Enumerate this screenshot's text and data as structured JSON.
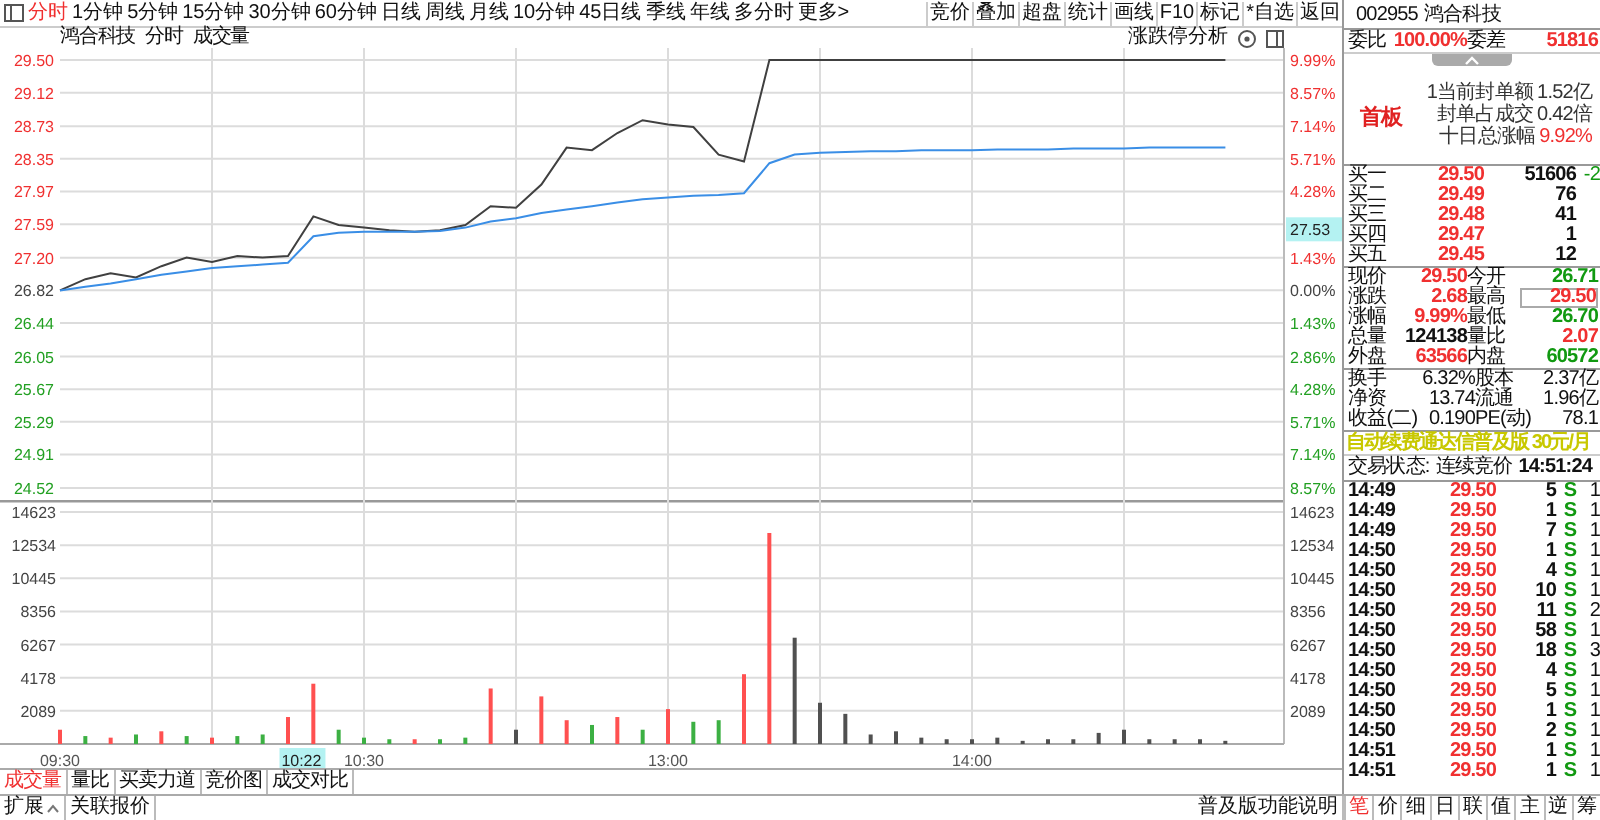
{
  "toolbar": {
    "period_tabs": [
      {
        "label": "分时",
        "selected": true
      },
      {
        "label": "1分钟",
        "selected": false
      },
      {
        "label": "5分钟",
        "selected": false
      },
      {
        "label": "15分钟",
        "selected": false
      },
      {
        "label": "30分钟",
        "selected": false
      },
      {
        "label": "60分钟",
        "selected": false
      },
      {
        "label": "日线",
        "selected": false
      },
      {
        "label": "周线",
        "selected": false
      },
      {
        "label": "月线",
        "selected": false
      },
      {
        "label": "10分钟",
        "selected": false
      },
      {
        "label": "45日线",
        "selected": false
      },
      {
        "label": "季线",
        "selected": false
      },
      {
        "label": "年线",
        "selected": false
      },
      {
        "label": "多分时",
        "selected": false
      },
      {
        "label": "更多>",
        "selected": false
      }
    ],
    "tools": [
      "竞价",
      "叠加",
      "超盘",
      "统计",
      "画线",
      "F10",
      "标记",
      "*自选",
      "返回"
    ]
  },
  "chart": {
    "header": {
      "name": "鸿合科技",
      "mode": "分时",
      "indicator": "成交量",
      "analysis": "涨跌停分析"
    },
    "price": {
      "cursor_label": "27.53",
      "right_ticks": [
        "9.99%",
        "8.57%",
        "7.14%",
        "5.71%",
        "4.28%",
        "1.43%",
        "0.00%",
        "1.43%",
        "2.86%",
        "4.28%",
        "5.71%",
        "7.14%",
        "8.57%"
      ],
      "chart_data": {
        "type": "line",
        "grid": true,
        "categories": [
          null,
          null,
          null,
          null,
          null,
          null,
          null,
          null,
          null,
          null,
          null,
          null,
          null,
          null,
          null,
          null,
          null,
          null,
          null,
          null,
          null,
          null,
          null,
          null,
          null,
          null,
          null,
          null,
          null,
          null,
          null,
          null,
          null,
          null,
          null,
          null,
          null,
          null,
          null,
          null,
          null,
          null,
          null,
          null,
          null,
          null,
          null
        ],
        "series": [
          {
            "color": "#404040",
            "values": [
              26.82,
              26.95,
              27.02,
              26.97,
              27.1,
              27.2,
              27.15,
              27.22,
              27.2,
              27.22,
              27.68,
              27.58,
              27.55,
              27.52,
              27.5,
              27.52,
              27.58,
              27.8,
              27.78,
              28.05,
              28.48,
              28.45,
              28.65,
              28.8,
              28.75,
              28.72,
              28.4,
              28.32,
              29.5,
              29.5,
              29.5,
              29.5,
              29.5,
              29.5,
              29.5,
              29.5,
              29.5,
              29.5,
              29.5,
              29.5,
              29.5,
              29.5,
              29.5,
              29.5,
              29.5,
              29.5,
              29.5
            ]
          },
          {
            "color": "#3a8ee6",
            "values": [
              26.82,
              26.86,
              26.9,
              26.95,
              27.0,
              27.04,
              27.08,
              27.1,
              27.12,
              27.14,
              27.45,
              27.49,
              27.5,
              27.5,
              27.5,
              27.51,
              27.55,
              27.62,
              27.66,
              27.72,
              27.76,
              27.8,
              27.84,
              27.88,
              27.9,
              27.92,
              27.93,
              27.95,
              28.3,
              28.4,
              28.42,
              28.43,
              28.44,
              28.44,
              28.45,
              28.45,
              28.45,
              28.46,
              28.46,
              28.46,
              28.47,
              28.47,
              28.47,
              28.48,
              28.48,
              28.48,
              28.48
            ]
          }
        ],
        "ylim": [
          24.52,
          29.5
        ],
        "yticks": [
          {
            "value": 29.5,
            "label": "29.50"
          },
          {
            "value": 29.12,
            "label": "29.12"
          },
          {
            "value": 28.73,
            "label": "28.73"
          },
          {
            "value": 28.35,
            "label": "28.35"
          },
          {
            "value": 27.97,
            "label": "27.97"
          },
          {
            "value": 27.59,
            "label": "27.59"
          },
          {
            "value": 27.2,
            "label": "27.20"
          },
          {
            "value": 26.82,
            "label": "26.82"
          },
          {
            "value": 26.44,
            "label": "26.44"
          },
          {
            "value": 26.05,
            "label": "26.05"
          },
          {
            "value": 25.67,
            "label": "25.67"
          },
          {
            "value": 25.29,
            "label": "25.29"
          },
          {
            "value": 24.91,
            "label": "24.91"
          },
          {
            "value": 24.52,
            "label": "24.52"
          }
        ]
      }
    },
    "volume": {
      "right_ticks": [
        "14623",
        "12534",
        "10445",
        "8356",
        "6267",
        "4178",
        "2089"
      ],
      "cursor_time": "10:22",
      "chart_data": {
        "type": "bar",
        "grid": true,
        "stacked": true,
        "categories": [
          "09:30",
          null,
          null,
          null,
          null,
          null,
          null,
          null,
          null,
          null,
          null,
          null,
          "10:30",
          null,
          null,
          null,
          null,
          null,
          null,
          null,
          null,
          null,
          null,
          null,
          "13:00",
          null,
          null,
          null,
          null,
          null,
          null,
          null,
          null,
          null,
          null,
          null,
          "14:00",
          null,
          null,
          null,
          null,
          null,
          null,
          null,
          null,
          null,
          null
        ],
        "series": [
          {
            "color": "#ff5050",
            "values": [
              900,
              null,
              400,
              null,
              800,
              null,
              400,
              null,
              null,
              1700,
              3800,
              null,
              null,
              null,
              300,
              null,
              null,
              3500,
              null,
              3000,
              1500,
              null,
              1700,
              null,
              2200,
              null,
              null,
              4400,
              13300,
              null,
              null,
              null,
              null,
              null,
              null,
              null,
              null,
              null,
              null,
              null,
              null,
              null,
              null,
              null,
              null,
              null,
              null
            ]
          },
          {
            "color": "#3cb043",
            "values": [
              null,
              500,
              null,
              600,
              null,
              500,
              null,
              500,
              600,
              null,
              null,
              900,
              400,
              300,
              null,
              300,
              400,
              null,
              null,
              null,
              null,
              1200,
              null,
              900,
              null,
              1400,
              1500,
              null,
              null,
              null,
              null,
              null,
              null,
              null,
              null,
              null,
              null,
              null,
              null,
              null,
              null,
              null,
              null,
              null,
              null,
              null,
              null
            ]
          },
          {
            "color": "#505050",
            "values": [
              null,
              null,
              null,
              null,
              null,
              null,
              null,
              null,
              null,
              null,
              null,
              null,
              null,
              null,
              null,
              null,
              null,
              null,
              900,
              null,
              null,
              null,
              null,
              null,
              null,
              null,
              null,
              null,
              null,
              6700,
              2600,
              1900,
              600,
              800,
              400,
              300,
              300,
              400,
              200,
              300,
              300,
              700,
              900,
              300,
              300,
              300,
              200
            ]
          }
        ],
        "ylim": [
          0,
          14623
        ],
        "yticks": [
          2089,
          4178,
          6267,
          8356,
          10445,
          12534,
          14623
        ]
      }
    },
    "indicator_tabs": [
      {
        "label": "成交量",
        "selected": true
      },
      {
        "label": "量比",
        "selected": false
      },
      {
        "label": "买卖力道",
        "selected": false
      },
      {
        "label": "竞价图",
        "selected": false
      },
      {
        "label": "成交对比",
        "selected": false
      }
    ]
  },
  "quote": {
    "code": "002955",
    "name": "鸿合科技",
    "order_ratio": {
      "label": "委比",
      "value": "100.00%",
      "diff_label": "委差",
      "diff": "51816"
    },
    "limit_badge": "首板",
    "limit_info": [
      {
        "label": "1当前封单额",
        "value": "1.52亿",
        "highlight": false
      },
      {
        "label": "封单占成交",
        "value": "0.42倍",
        "highlight": false
      },
      {
        "label": "十日总涨幅",
        "value": "9.92%",
        "highlight": true
      }
    ],
    "bids": [
      {
        "label": "买一",
        "price": "29.50",
        "volume": "51606",
        "change": "-2"
      },
      {
        "label": "买二",
        "price": "29.49",
        "volume": "76"
      },
      {
        "label": "买三",
        "price": "29.48",
        "volume": "41"
      },
      {
        "label": "买四",
        "price": "29.47",
        "volume": "1"
      },
      {
        "label": "买五",
        "price": "29.45",
        "volume": "12"
      }
    ],
    "stats": [
      {
        "label": "现价",
        "value": "29.50",
        "color": "#f03030",
        "boxed": false
      },
      {
        "label": "今开",
        "value": "26.71",
        "color": "#119911",
        "boxed": false
      },
      {
        "label": "涨跌",
        "value": "2.68",
        "color": "#f03030",
        "boxed": false
      },
      {
        "label": "最高",
        "value": "29.50",
        "color": "#f03030",
        "boxed": true
      },
      {
        "label": "涨幅",
        "value": "9.99%",
        "color": "#f03030",
        "boxed": false
      },
      {
        "label": "最低",
        "value": "26.70",
        "color": "#119911",
        "boxed": false
      },
      {
        "label": "总量",
        "value": "124138",
        "color": "#111111",
        "boxed": false
      },
      {
        "label": "量比",
        "value": "2.07",
        "color": "#f03030",
        "boxed": false
      },
      {
        "label": "外盘",
        "value": "63566",
        "color": "#f03030",
        "boxed": false
      },
      {
        "label": "内盘",
        "value": "60572",
        "color": "#119911",
        "boxed": false
      }
    ],
    "fundamentals": [
      {
        "label": "换手",
        "value": "6.32%",
        "label2": "股本",
        "value2": "2.37亿"
      },
      {
        "label": "净资",
        "value": "13.74",
        "label2": "流通",
        "value2": "1.96亿"
      },
      {
        "label": "收益(二)",
        "value": "0.190",
        "label2": "PE(动)",
        "value2": "78.1"
      }
    ],
    "promo": "自动续费通达信普及版 30元/月",
    "trade_status": {
      "label": "交易状态:",
      "value": "连续竞价",
      "time": "14:51:24"
    },
    "ticks": [
      {
        "time": "14:49",
        "price": "29.50",
        "volume": "5",
        "side": "S",
        "kind": "sell",
        "count": "1"
      },
      {
        "time": "14:49",
        "price": "29.50",
        "volume": "1",
        "side": "S",
        "kind": "sell",
        "count": "1"
      },
      {
        "time": "14:49",
        "price": "29.50",
        "volume": "7",
        "side": "S",
        "kind": "sell",
        "count": "1"
      },
      {
        "time": "14:50",
        "price": "29.50",
        "volume": "1",
        "side": "S",
        "kind": "sell",
        "count": "1"
      },
      {
        "time": "14:50",
        "price": "29.50",
        "volume": "4",
        "side": "S",
        "kind": "sell",
        "count": "1"
      },
      {
        "time": "14:50",
        "price": "29.50",
        "volume": "10",
        "side": "S",
        "kind": "sell",
        "count": "1"
      },
      {
        "time": "14:50",
        "price": "29.50",
        "volume": "11",
        "side": "S",
        "kind": "sell",
        "count": "2"
      },
      {
        "time": "14:50",
        "price": "29.50",
        "volume": "58",
        "side": "S",
        "kind": "sell",
        "count": "1"
      },
      {
        "time": "14:50",
        "price": "29.50",
        "volume": "18",
        "side": "S",
        "kind": "sell",
        "count": "3"
      },
      {
        "time": "14:50",
        "price": "29.50",
        "volume": "4",
        "side": "S",
        "kind": "sell",
        "count": "1"
      },
      {
        "time": "14:50",
        "price": "29.50",
        "volume": "5",
        "side": "S",
        "kind": "sell",
        "count": "1"
      },
      {
        "time": "14:50",
        "price": "29.50",
        "volume": "1",
        "side": "S",
        "kind": "sell",
        "count": "1"
      },
      {
        "time": "14:50",
        "price": "29.50",
        "volume": "2",
        "side": "S",
        "kind": "sell",
        "count": "1"
      },
      {
        "time": "14:51",
        "price": "29.50",
        "volume": "1",
        "side": "S",
        "kind": "sell",
        "count": "1"
      },
      {
        "time": "14:51",
        "price": "29.50",
        "volume": "1",
        "side": "S",
        "kind": "sell",
        "count": "1"
      }
    ]
  },
  "bottom": {
    "expand": "扩展",
    "related": "关联报价",
    "help_link": "普及版功能说明",
    "detail_tabs": [
      {
        "label": "笔",
        "selected": true
      },
      {
        "label": "价",
        "selected": false
      },
      {
        "label": "细",
        "selected": false
      },
      {
        "label": "日",
        "selected": false
      },
      {
        "label": "联",
        "selected": false
      },
      {
        "label": "值",
        "selected": false
      },
      {
        "label": "主",
        "selected": false
      },
      {
        "label": "逆",
        "selected": false
      },
      {
        "label": "筹",
        "selected": false
      }
    ]
  }
}
